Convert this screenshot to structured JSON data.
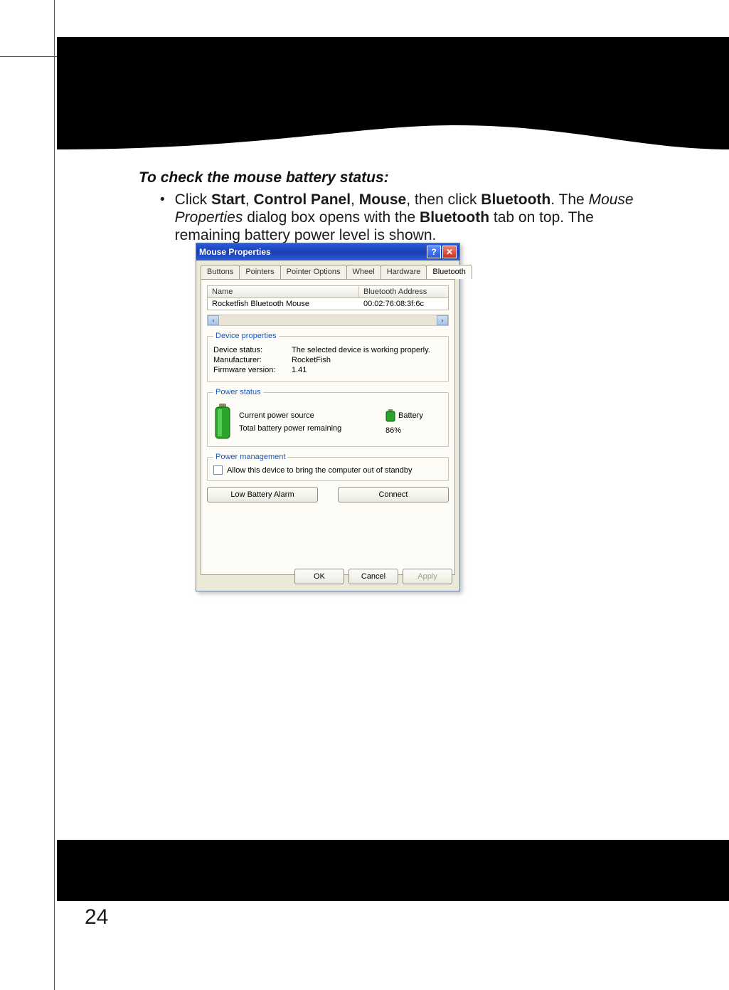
{
  "page": {
    "heading": "To check the mouse battery status:",
    "bullet_html_parts": {
      "p1": "Click ",
      "b1": "Start",
      "c1": ", ",
      "b2": "Control Panel",
      "c2": ", ",
      "b3": "Mouse",
      "c3": ", then click ",
      "b4": "Bluetooth",
      "c4": ". The ",
      "i1": "Mouse Properties",
      "c5": " dialog box opens with the ",
      "b5": "Bluetooth",
      "c6": " tab on top. The remaining battery power level is shown."
    },
    "number": "24"
  },
  "dialog": {
    "title": "Mouse Properties",
    "help_glyph": "?",
    "close_glyph": "✕",
    "tabs": [
      "Buttons",
      "Pointers",
      "Pointer Options",
      "Wheel",
      "Hardware",
      "Bluetooth"
    ],
    "active_tab_index": 5,
    "list": {
      "headers": {
        "name": "Name",
        "addr": "Bluetooth Address"
      },
      "row": {
        "name": "Rocketfish Bluetooth Mouse",
        "addr": "00:02:76:08:3f:6c"
      },
      "scroll_left": "‹",
      "scroll_right": "›"
    },
    "device_props": {
      "legend": "Device properties",
      "status_k": "Device status:",
      "status_v": "The selected device is working properly.",
      "mfr_k": "Manufacturer:",
      "mfr_v": "RocketFish",
      "fw_k": "Firmware version:",
      "fw_v": "1.41"
    },
    "power_status": {
      "legend": "Power status",
      "source_k": "Current power source",
      "source_v": "Battery",
      "remain_k": "Total battery power remaining",
      "remain_v": "86%"
    },
    "power_mgmt": {
      "legend": "Power management",
      "checkbox_label": "Allow this device to bring the computer out of standby"
    },
    "buttons": {
      "low_alarm": "Low Battery Alarm",
      "connect": "Connect",
      "ok": "OK",
      "cancel": "Cancel",
      "apply": "Apply"
    }
  }
}
